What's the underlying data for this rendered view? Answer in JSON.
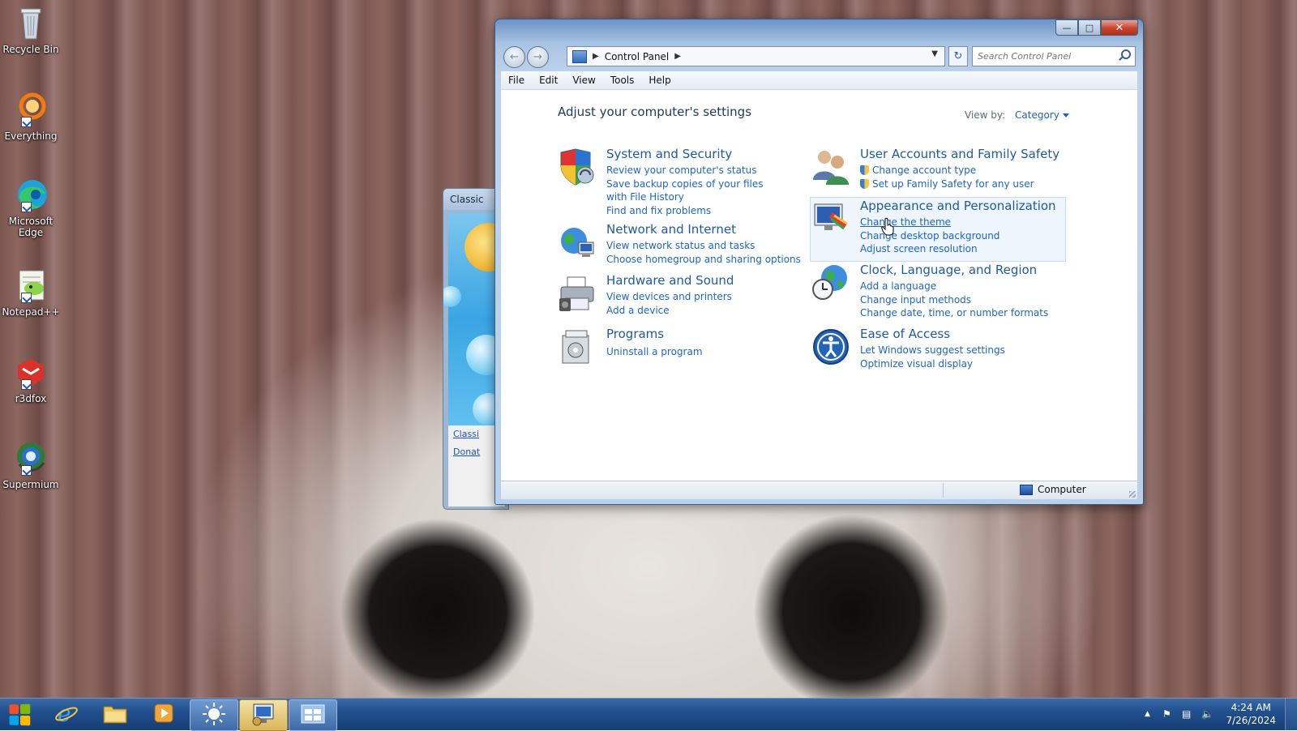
{
  "desktop": {
    "icons": [
      {
        "label": "Recycle Bin"
      },
      {
        "label": "Everything"
      },
      {
        "label": "Microsoft Edge"
      },
      {
        "label": "Notepad++"
      },
      {
        "label": "r3dfox"
      },
      {
        "label": "Supermium"
      }
    ]
  },
  "background_window": {
    "title": "Classic",
    "links": [
      "Classi",
      "Donat"
    ]
  },
  "window": {
    "breadcrumb": "Control Panel",
    "search_placeholder": "Search Control Panel",
    "menu": [
      "File",
      "Edit",
      "View",
      "Tools",
      "Help"
    ],
    "heading": "Adjust your computer's settings",
    "view_by_label": "View by:",
    "view_by_value": "Category",
    "categories": [
      {
        "title": "System and Security",
        "links": [
          "Review your computer's status",
          "Save backup copies of your files with File History",
          "Find and fix problems"
        ]
      },
      {
        "title": "Network and Internet",
        "links": [
          "View network status and tasks",
          "Choose homegroup and sharing options"
        ]
      },
      {
        "title": "Hardware and Sound",
        "links": [
          "View devices and printers",
          "Add a device"
        ]
      },
      {
        "title": "Programs",
        "links": [
          "Uninstall a program"
        ]
      },
      {
        "title": "User Accounts and Family Safety",
        "links": [
          "Change account type",
          "Set up Family Safety for any user"
        ]
      },
      {
        "title": "Appearance and Personalization",
        "links": [
          "Change the theme",
          "Change desktop background",
          "Adjust screen resolution"
        ]
      },
      {
        "title": "Clock, Language, and Region",
        "links": [
          "Add a language",
          "Change input methods",
          "Change date, time, or number formats"
        ]
      },
      {
        "title": "Ease of Access",
        "links": [
          "Let Windows suggest settings",
          "Optimize visual display"
        ]
      }
    ],
    "status": "Computer"
  },
  "taskbar": {
    "time": "4:24 AM",
    "date": "7/26/2024"
  },
  "colors": {
    "link": "#1e65bf",
    "category_title": "#1e5a9e",
    "heading": "#1e395b",
    "taskbar": "#22508f"
  }
}
